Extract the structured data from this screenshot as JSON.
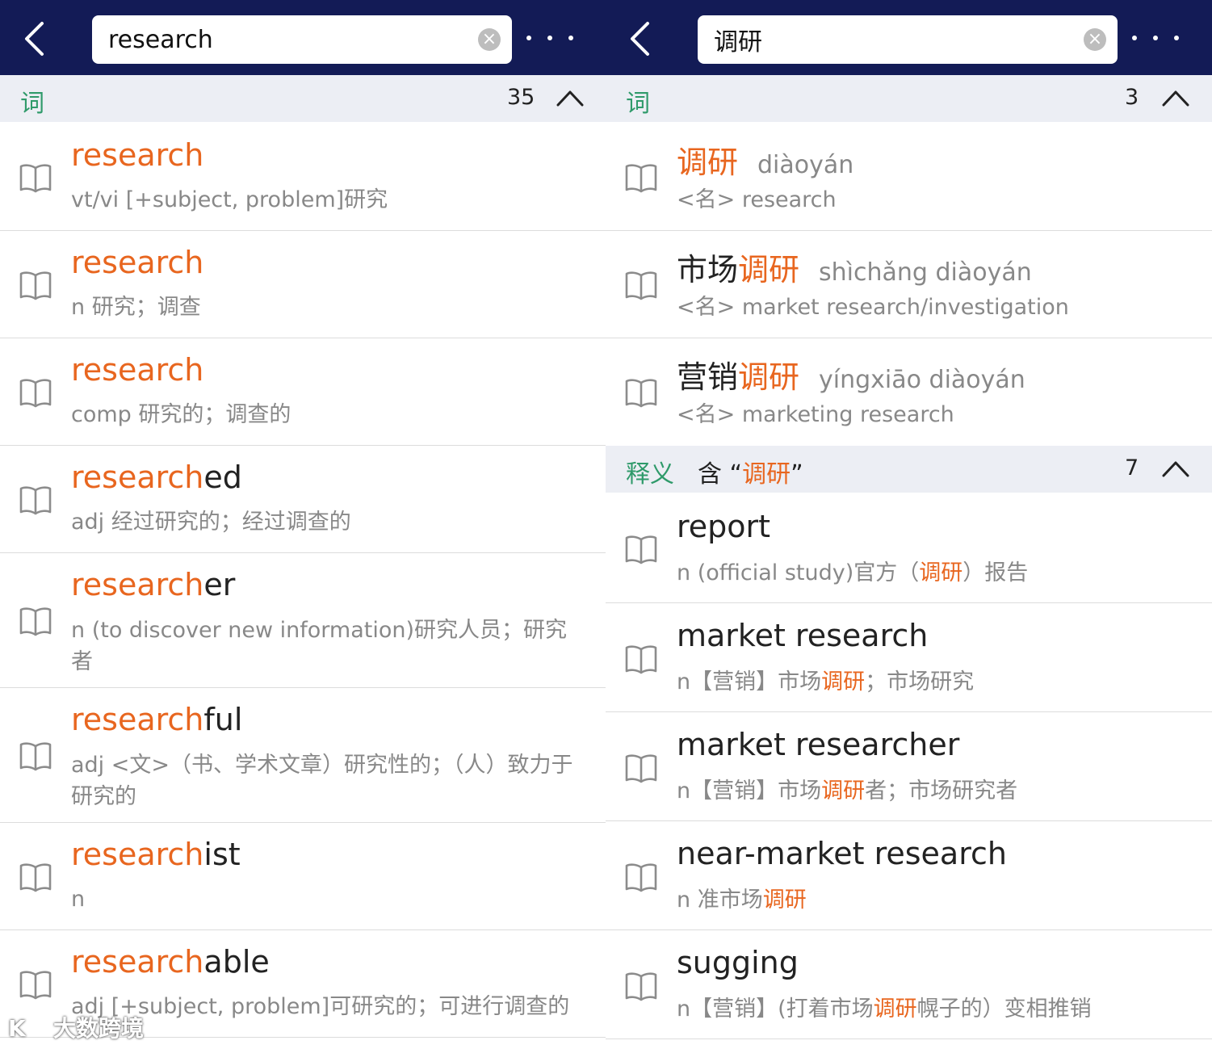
{
  "left": {
    "search_value": "research",
    "section": {
      "label": "词",
      "count": "35"
    },
    "entries": [
      {
        "stem": "research",
        "suffix": "",
        "def": "vt/vi [+subject, problem]研究"
      },
      {
        "stem": "research",
        "suffix": "",
        "def": "n 研究；调查"
      },
      {
        "stem": "research",
        "suffix": "",
        "def": "comp 研究的；调查的"
      },
      {
        "stem": "research",
        "suffix": "ed",
        "def": "adj 经过研究的；经过调查的"
      },
      {
        "stem": "research",
        "suffix": "er",
        "def": "n (to discover new information)研究人员；研究者"
      },
      {
        "stem": "research",
        "suffix": "ful",
        "def": "adj <文>（书、学术文章）研究性的；（人）致力于研究的"
      },
      {
        "stem": "research",
        "suffix": "ist",
        "def": "n"
      },
      {
        "stem": "research",
        "suffix": "able",
        "def": "adj [+subject, problem]可研究的；可进行调查的"
      }
    ]
  },
  "right": {
    "search_value": "调研",
    "section_words": {
      "label": "词",
      "count": "3"
    },
    "words": [
      {
        "pre": "",
        "hl": "调研",
        "pinyin": "diàoyán",
        "def": "<名> research"
      },
      {
        "pre": "市场",
        "hl": "调研",
        "pinyin": "shìchǎng diàoyán",
        "def": "<名> market research/investigation"
      },
      {
        "pre": "营销",
        "hl": "调研",
        "pinyin": "yíngxiāo diàoyán",
        "def": "<名> marketing research"
      }
    ],
    "section_defs": {
      "label": "释义",
      "desc_pre": "含 “",
      "desc_hl": "调研",
      "desc_post": "”",
      "count": "7"
    },
    "defs": [
      {
        "word": "report",
        "d_pre": "n (official study)官方（",
        "d_hl": "调研",
        "d_post": "）报告"
      },
      {
        "word": "market research",
        "d_pre": "n【营销】市场",
        "d_hl": "调研",
        "d_post": "；市场研究"
      },
      {
        "word": "market researcher",
        "d_pre": "n【营销】市场",
        "d_hl": "调研",
        "d_post": "者；市场研究者"
      },
      {
        "word": "near-market research",
        "d_pre": "n 准市场",
        "d_hl": "调研",
        "d_post": ""
      },
      {
        "word": "sugging",
        "d_pre": "n【营销】(打着市场",
        "d_hl": "调研",
        "d_post": "幌子的）变相推销"
      }
    ]
  },
  "watermark": {
    "logo": "K",
    "text": "大数跨境"
  },
  "colors": {
    "topbar": "#131b56",
    "highlight": "#e8661f",
    "section_label": "#2f9a6a",
    "section_bg": "#eceef4"
  }
}
